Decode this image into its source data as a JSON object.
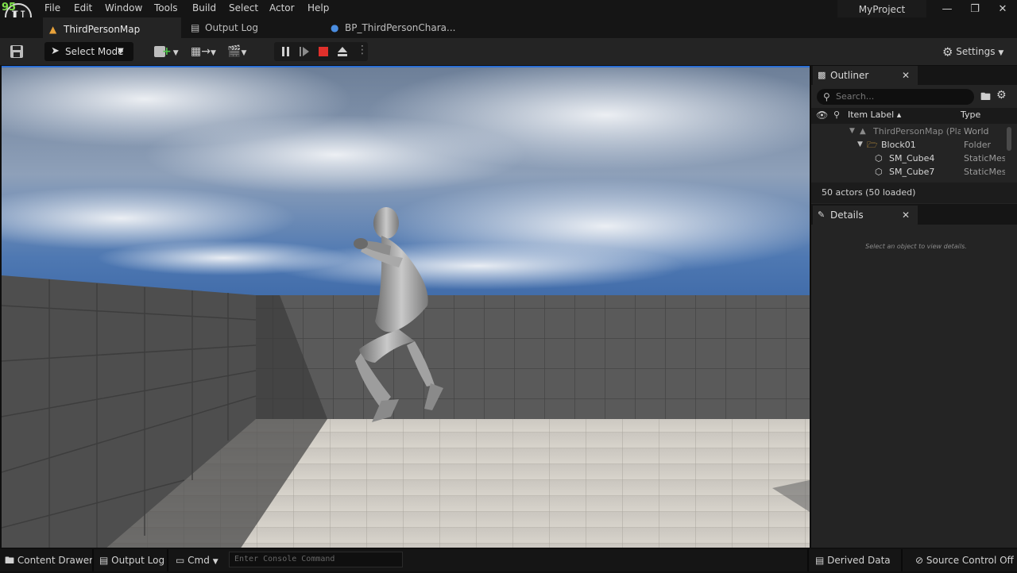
{
  "fps": "95",
  "menu": [
    "File",
    "Edit",
    "Window",
    "Tools",
    "Build",
    "Select",
    "Actor",
    "Help"
  ],
  "project_name": "MyProject",
  "tabs": [
    {
      "label": "ThirdPersonMap"
    },
    {
      "label": "Output Log"
    },
    {
      "label": "BP_ThirdPersonChara..."
    }
  ],
  "toolbar": {
    "select_mode": "Select Mode",
    "settings": "Settings"
  },
  "outliner": {
    "tab_label": "Outliner",
    "search_placeholder": "Search...",
    "columns": {
      "label": "Item Label ▴",
      "type": "Type"
    },
    "rows": [
      {
        "label": "ThirdPersonMap (Pla",
        "type": "World"
      },
      {
        "label": "Block01",
        "type": "Folder"
      },
      {
        "label": "SM_Cube4",
        "type": "StaticMes"
      },
      {
        "label": "SM_Cube7",
        "type": "StaticMes"
      }
    ],
    "actor_count": "50 actors (50 loaded)"
  },
  "details": {
    "tab_label": "Details",
    "empty_message": "Select an object to view details."
  },
  "statusbar": {
    "content_drawer": "Content Drawer",
    "output_log": "Output Log",
    "cmd": "Cmd",
    "console_placeholder": "Enter Console Command",
    "derived_data": "Derived Data",
    "source_control": "Source Control Off"
  },
  "colors": {
    "accent": "#2b6fd6",
    "stop": "#e0302b",
    "fps": "#7ee04a",
    "folder": "#d9a441"
  }
}
